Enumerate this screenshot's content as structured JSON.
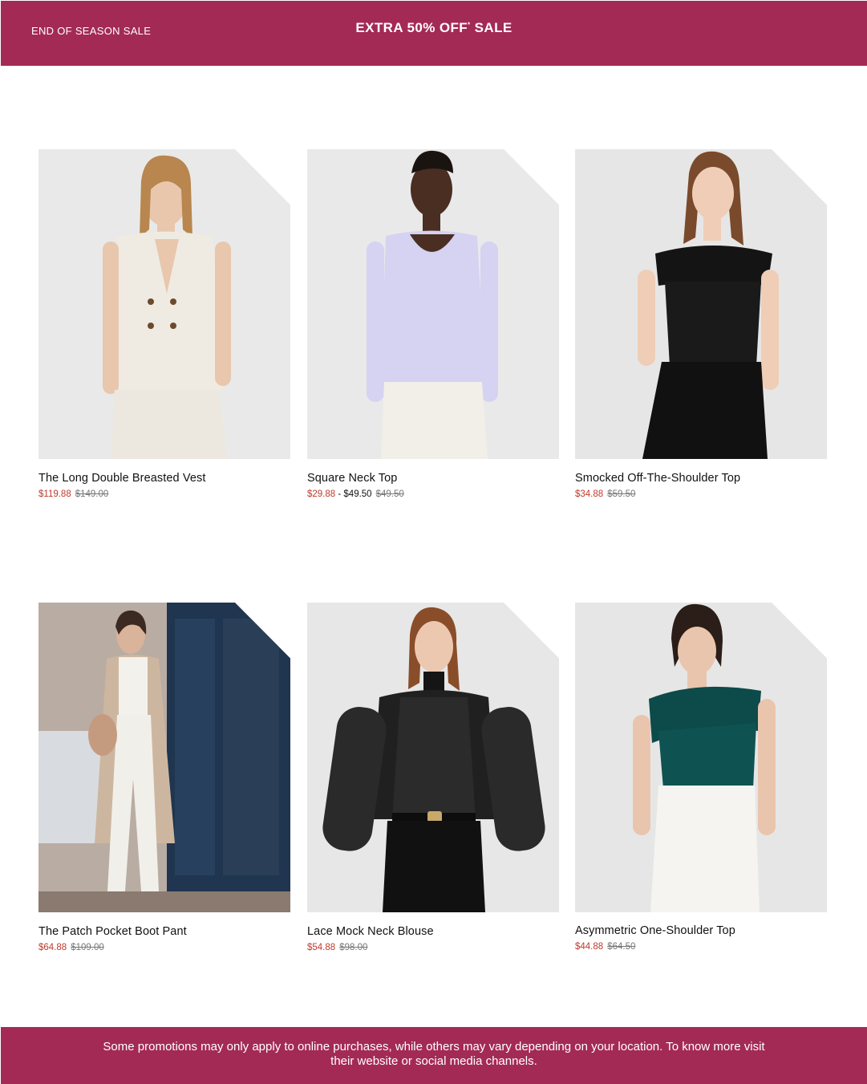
{
  "banner": {
    "left_text": "END OF SEASON SALE",
    "headline_a": "EXTRA 50% OFF",
    "headline_mark": "*",
    "headline_b": " SALE",
    "color": "#a32a55"
  },
  "products": [
    {
      "name": "The Long Double Breasted Vest",
      "sale_price": "$119.88",
      "extra_price": "",
      "original_price": "$149.00"
    },
    {
      "name": "Square Neck Top",
      "sale_price": "$29.88",
      "extra_price": " - $49.50",
      "original_price": "$49.50"
    },
    {
      "name": "Smocked Off-The-Shoulder Top",
      "sale_price": "$34.88",
      "extra_price": "",
      "original_price": "$59.50"
    },
    {
      "name": "The Patch Pocket Boot Pant",
      "sale_price": "$64.88",
      "extra_price": "",
      "original_price": "$109.00"
    },
    {
      "name": "Lace Mock Neck Blouse",
      "sale_price": "$54.88",
      "extra_price": "",
      "original_price": "$98.00"
    },
    {
      "name": "Asymmetric One-Shoulder Top",
      "sale_price": "$44.88",
      "extra_price": "",
      "original_price": "$64.50"
    }
  ],
  "footer": {
    "disclaimer": "Some promotions may only apply to online purchases, while others may vary depending on your location. To know more visit their website or social media channels."
  }
}
